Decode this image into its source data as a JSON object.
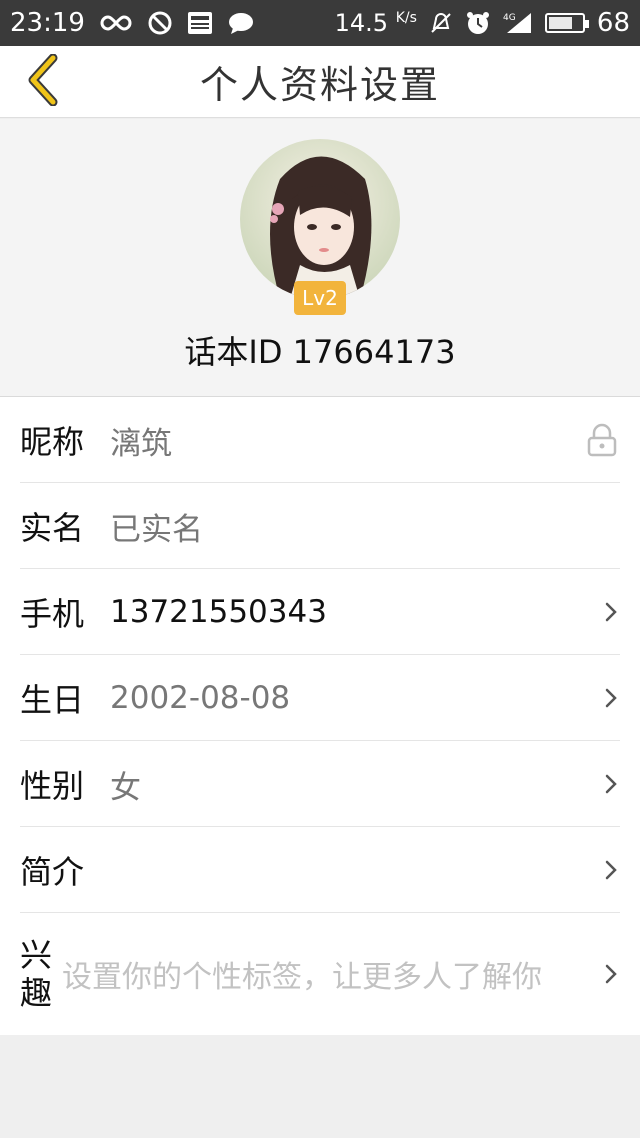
{
  "status_bar": {
    "time": "23:19",
    "speed": "14.5",
    "speed_unit": "K/s",
    "network": "4G",
    "battery": "68",
    "battery_level": 0.68,
    "icons": [
      "infinity-icon",
      "block-icon",
      "news-icon",
      "chat-icon",
      "mute-icon",
      "alarm-icon",
      "signal-icon",
      "battery-icon"
    ]
  },
  "header": {
    "title": "个人资料设置",
    "back_icon": "chevron-left-icon",
    "accent_color": "#f0c419"
  },
  "profile": {
    "level": "Lv2",
    "user_id": "话本ID 17664173",
    "badge_color": "#f2b43c"
  },
  "fields": {
    "nickname": {
      "label": "昵称",
      "value": "漓筑",
      "icon": "lock-icon"
    },
    "realname": {
      "label": "实名",
      "value": "已实名"
    },
    "phone": {
      "label": "手机",
      "value": "13721550343"
    },
    "birthday": {
      "label": "生日",
      "value": "2002-08-08"
    },
    "gender": {
      "label": "性别",
      "value": "女"
    },
    "bio": {
      "label": "简介",
      "value": ""
    },
    "interests": {
      "label": "兴趣",
      "placeholder": "设置你的个性标签，让更多人了解你"
    }
  }
}
